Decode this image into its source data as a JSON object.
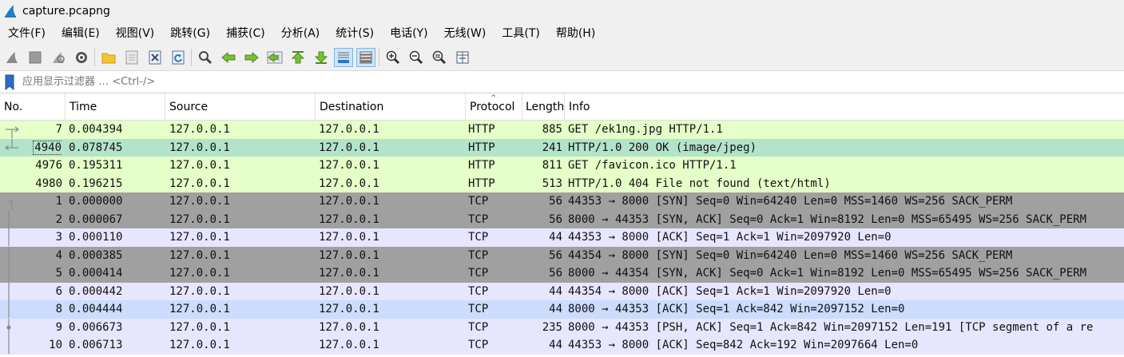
{
  "window": {
    "title": "capture.pcapng"
  },
  "menu": [
    "文件(F)",
    "编辑(E)",
    "视图(V)",
    "跳转(G)",
    "捕获(C)",
    "分析(A)",
    "统计(S)",
    "电话(Y)",
    "无线(W)",
    "工具(T)",
    "帮助(H)"
  ],
  "toolbar": {
    "icons": [
      "start-capture-icon",
      "stop-capture-icon",
      "restart-capture-icon",
      "capture-options-icon",
      "open-file-icon",
      "save-file-icon",
      "close-file-icon",
      "reload-file-icon",
      "find-packet-icon",
      "go-back-icon",
      "go-forward-icon",
      "go-to-packet-icon",
      "go-first-icon",
      "go-last-icon",
      "auto-scroll-icon",
      "colorize-icon",
      "zoom-in-icon",
      "zoom-out-icon",
      "normal-size-icon",
      "resize-columns-icon"
    ]
  },
  "filter": {
    "placeholder": "应用显示过滤器 … <Ctrl-/>"
  },
  "columns": [
    "No.",
    "Time",
    "Source",
    "Destination",
    "Protocol",
    "Length",
    "Info"
  ],
  "colors": {
    "http": "#e4ffc7",
    "http_selected": "#b3e3cb",
    "tcp_syn": "#a0a0a0",
    "tcp": "#e7e6ff",
    "tcp_selected": "#cbdcfd"
  },
  "packets": [
    {
      "no": "7",
      "time": "0.004394",
      "src": "127.0.0.1",
      "dst": "127.0.0.1",
      "proto": "HTTP",
      "len": "885",
      "info": "GET /ek1ng.jpg HTTP/1.1",
      "color": "#e4ffc7",
      "related": "request"
    },
    {
      "no": "4940",
      "time": "0.078745",
      "src": "127.0.0.1",
      "dst": "127.0.0.1",
      "proto": "HTTP",
      "len": "241",
      "info": "HTTP/1.0 200 OK  (image/jpeg)",
      "color": "#b3e3cb",
      "related": "response",
      "focused": true
    },
    {
      "no": "4976",
      "time": "0.195311",
      "src": "127.0.0.1",
      "dst": "127.0.0.1",
      "proto": "HTTP",
      "len": "811",
      "info": "GET /favicon.ico HTTP/1.1",
      "color": "#e4ffc7",
      "related": ""
    },
    {
      "no": "4980",
      "time": "0.196215",
      "src": "127.0.0.1",
      "dst": "127.0.0.1",
      "proto": "HTTP",
      "len": "513",
      "info": "HTTP/1.0 404 File not found  (text/html)",
      "color": "#e4ffc7",
      "related": ""
    },
    {
      "no": "1",
      "time": "0.000000",
      "src": "127.0.0.1",
      "dst": "127.0.0.1",
      "proto": "TCP",
      "len": "56",
      "info": "44353 → 8000 [SYN] Seq=0 Win=64240 Len=0 MSS=1460 WS=256 SACK_PERM",
      "color": "#a0a0a0",
      "related": "start"
    },
    {
      "no": "2",
      "time": "0.000067",
      "src": "127.0.0.1",
      "dst": "127.0.0.1",
      "proto": "TCP",
      "len": "56",
      "info": "8000 → 44353 [SYN, ACK] Seq=0 Ack=1 Win=8192 Len=0 MSS=65495 WS=256 SACK_PERM",
      "color": "#a0a0a0",
      "related": "line"
    },
    {
      "no": "3",
      "time": "0.000110",
      "src": "127.0.0.1",
      "dst": "127.0.0.1",
      "proto": "TCP",
      "len": "44",
      "info": "44353 → 8000 [ACK] Seq=1 Ack=1 Win=2097920 Len=0",
      "color": "#e7e6ff",
      "related": "line"
    },
    {
      "no": "4",
      "time": "0.000385",
      "src": "127.0.0.1",
      "dst": "127.0.0.1",
      "proto": "TCP",
      "len": "56",
      "info": "44354 → 8000 [SYN] Seq=0 Win=64240 Len=0 MSS=1460 WS=256 SACK_PERM",
      "color": "#a0a0a0",
      "related": "line"
    },
    {
      "no": "5",
      "time": "0.000414",
      "src": "127.0.0.1",
      "dst": "127.0.0.1",
      "proto": "TCP",
      "len": "56",
      "info": "8000 → 44354 [SYN, ACK] Seq=0 Ack=1 Win=8192 Len=0 MSS=65495 WS=256 SACK_PERM",
      "color": "#a0a0a0",
      "related": "line"
    },
    {
      "no": "6",
      "time": "0.000442",
      "src": "127.0.0.1",
      "dst": "127.0.0.1",
      "proto": "TCP",
      "len": "44",
      "info": "44354 → 8000 [ACK] Seq=1 Ack=1 Win=2097920 Len=0",
      "color": "#e7e6ff",
      "related": "line"
    },
    {
      "no": "8",
      "time": "0.004444",
      "src": "127.0.0.1",
      "dst": "127.0.0.1",
      "proto": "TCP",
      "len": "44",
      "info": "8000 → 44353 [ACK] Seq=1 Ack=842 Win=2097152 Len=0",
      "color": "#cbdcfd",
      "related": "line"
    },
    {
      "no": "9",
      "time": "0.006673",
      "src": "127.0.0.1",
      "dst": "127.0.0.1",
      "proto": "TCP",
      "len": "235",
      "info": "8000 → 44353 [PSH, ACK] Seq=1 Ack=842 Win=2097152 Len=191 [TCP segment of a re",
      "color": "#e7e6ff",
      "related": "dot"
    },
    {
      "no": "10",
      "time": "0.006713",
      "src": "127.0.0.1",
      "dst": "127.0.0.1",
      "proto": "TCP",
      "len": "44",
      "info": "44353 → 8000 [ACK] Seq=842 Ack=192 Win=2097664 Len=0",
      "color": "#e7e6ff",
      "related": "line"
    }
  ]
}
